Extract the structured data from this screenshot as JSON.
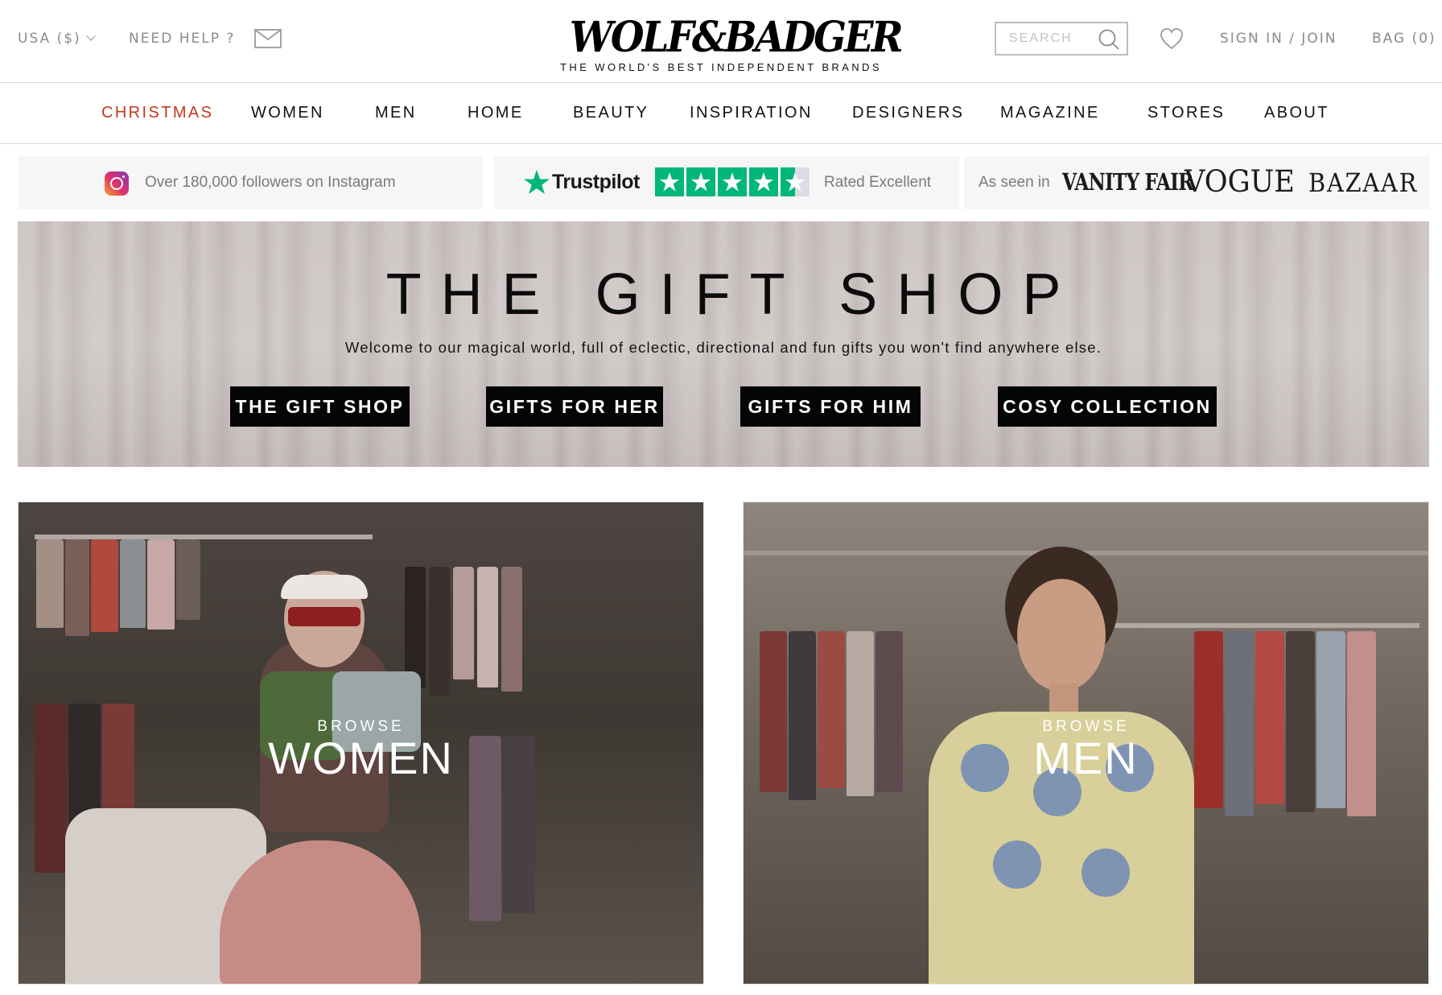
{
  "utility": {
    "currency": "USA ($)",
    "help": "NEED HELP ?",
    "sign_in": "SIGN IN / JOIN",
    "bag": "BAG (0)",
    "search_placeholder": "SEARCH"
  },
  "brand": {
    "logo": "WOLF&BADGER",
    "tagline": "THE WORLD'S BEST INDEPENDENT BRANDS"
  },
  "nav": [
    {
      "label": "CHRISTMAS",
      "highlight": true
    },
    {
      "label": "WOMEN"
    },
    {
      "label": "MEN"
    },
    {
      "label": "HOME"
    },
    {
      "label": "BEAUTY"
    },
    {
      "label": "INSPIRATION"
    },
    {
      "label": "DESIGNERS"
    },
    {
      "label": "MAGAZINE"
    },
    {
      "label": "STORES"
    },
    {
      "label": "ABOUT"
    }
  ],
  "trust": {
    "instagram": "Over 180,000 followers on Instagram",
    "trustpilot_brand": "Trustpilot",
    "trustpilot_rating": 4.5,
    "trustpilot_text": "Rated Excellent",
    "press_label": "As seen in",
    "press": [
      "VANITY FAIR",
      "VOGUE",
      "BAZAAR"
    ]
  },
  "hero": {
    "title": "THE GIFT SHOP",
    "subtitle": "Welcome to our magical world, full of eclectic, directional and fun gifts you won't find anywhere else.",
    "buttons": [
      "THE GIFT SHOP",
      "GIFTS FOR HER",
      "GIFTS FOR HIM",
      "COSY COLLECTION"
    ]
  },
  "tiles": [
    {
      "kicker": "BROWSE",
      "title": "WOMEN"
    },
    {
      "kicker": "BROWSE",
      "title": "MEN"
    }
  ],
  "colors": {
    "highlight": "#c4381e",
    "trustpilot_green": "#00b67a",
    "button_bg": "#050505"
  }
}
